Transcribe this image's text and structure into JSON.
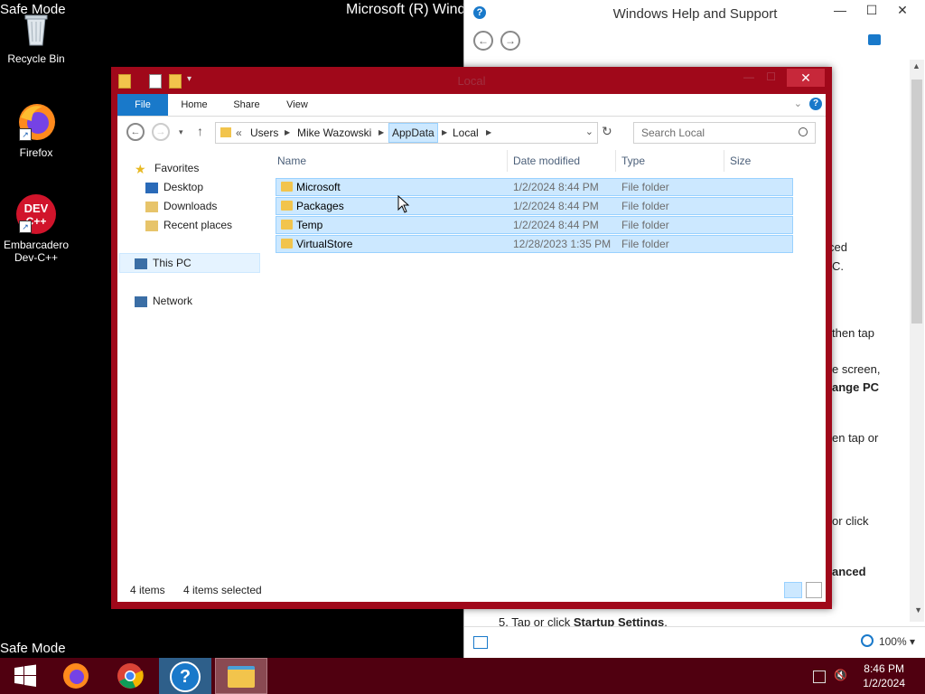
{
  "desktop": {
    "safe_mode_top": "Safe Mode",
    "safe_mode_bottom": "Safe Mode",
    "top_title": "Microsoft (R) Windo",
    "icons": [
      {
        "label": "Recycle Bin"
      },
      {
        "label": "Firefox"
      },
      {
        "label": "Embarcadero Dev-C++",
        "logo": "DEV C++"
      }
    ]
  },
  "help_window": {
    "title": "Windows Help and Support",
    "visible_fragments": [
      "ced",
      "C.",
      "then tap",
      "e screen,",
      "ange PC",
      "en tap or",
      "or click",
      "anced"
    ],
    "step": {
      "number": "5.",
      "text": "Tap or click ",
      "bold": "Startup Settings",
      "end": "."
    },
    "zoom": "100%"
  },
  "explorer": {
    "title": "Local",
    "ribbon_tabs": [
      "File",
      "Home",
      "Share",
      "View"
    ],
    "breadcrumb": {
      "overflow": "«",
      "parts": [
        "Users",
        "Mike Wazowski",
        "AppData",
        "Local"
      ]
    },
    "search_placeholder": "Search Local",
    "nav": {
      "favorites": "Favorites",
      "desktop": "Desktop",
      "downloads": "Downloads",
      "recent": "Recent places",
      "this_pc": "This PC",
      "network": "Network"
    },
    "columns": [
      "Name",
      "Date modified",
      "Type",
      "Size"
    ],
    "rows": [
      {
        "name": "Microsoft",
        "date": "1/2/2024 8:44 PM",
        "type": "File folder"
      },
      {
        "name": "Packages",
        "date": "1/2/2024 8:44 PM",
        "type": "File folder"
      },
      {
        "name": "Temp",
        "date": "1/2/2024 8:44 PM",
        "type": "File folder"
      },
      {
        "name": "VirtualStore",
        "date": "12/28/2023 1:35 PM",
        "type": "File folder"
      }
    ],
    "status": {
      "count": "4 items",
      "selected": "4 items selected"
    }
  },
  "taskbar": {
    "time": "8:46 PM",
    "date": "1/2/2024"
  },
  "colors": {
    "explorer_border": "#a0081a",
    "taskbar": "#500010",
    "selection": "#cce8ff",
    "file_tab": "#1979ca"
  }
}
